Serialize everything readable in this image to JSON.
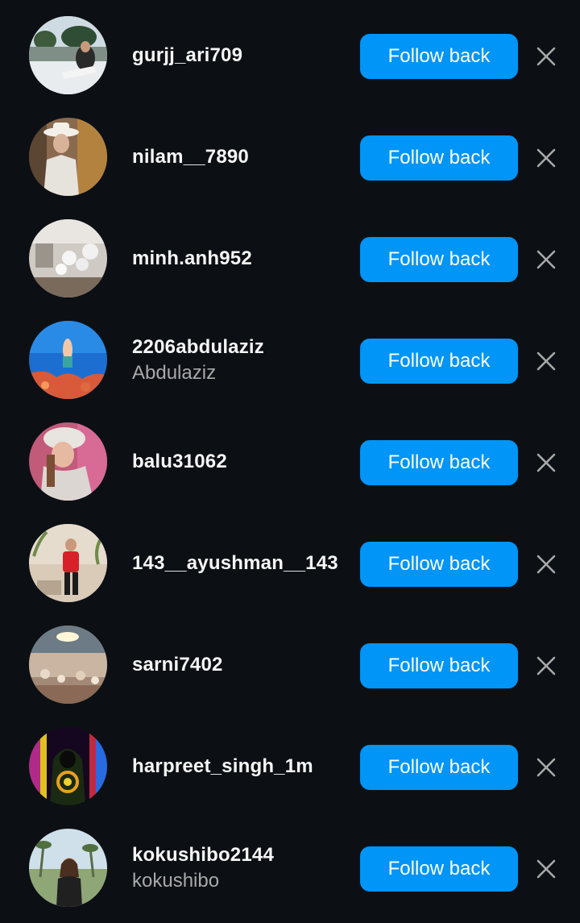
{
  "follow_label": "Follow back",
  "colors": {
    "background": "#0c1014",
    "accent": "#0095f6",
    "username": "#f5f5f5",
    "secondary": "#a8a8a8"
  },
  "followers": [
    {
      "username": "gurjj_ari709",
      "full_name": "",
      "avatar": "lake-portrait"
    },
    {
      "username": "nilam__7890",
      "full_name": "",
      "avatar": "hat-portrait"
    },
    {
      "username": "minh.anh952",
      "full_name": "",
      "avatar": "balloon-room"
    },
    {
      "username": "2206abdulaziz",
      "full_name": "Abdulaziz",
      "avatar": "underwater-diver"
    },
    {
      "username": "balu31062",
      "full_name": "",
      "avatar": "winter-portrait"
    },
    {
      "username": "143__ayushman__143",
      "full_name": "",
      "avatar": "red-outfit-portrait"
    },
    {
      "username": "sarni7402",
      "full_name": "",
      "avatar": "lit-hall"
    },
    {
      "username": "harpreet_singh_1m",
      "full_name": "",
      "avatar": "neon-hooded-figure"
    },
    {
      "username": "kokushibo2144",
      "full_name": "kokushibo",
      "avatar": "park-portrait"
    }
  ]
}
